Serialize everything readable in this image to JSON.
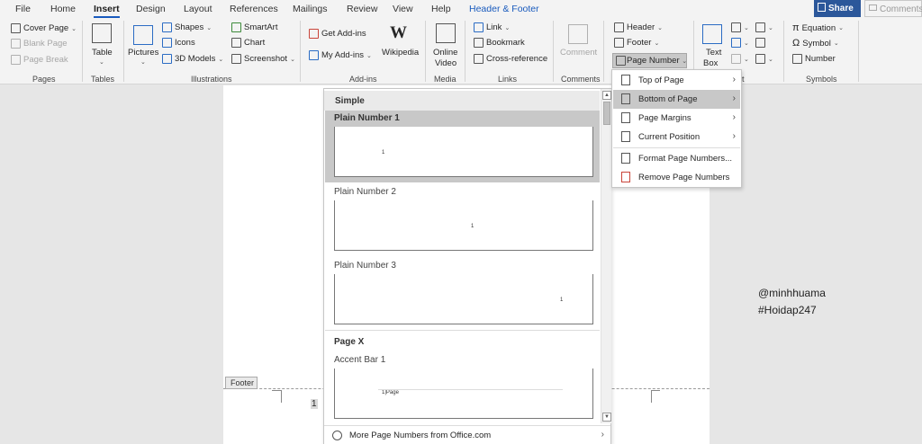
{
  "tabs": [
    "File",
    "Home",
    "Insert",
    "Design",
    "Layout",
    "References",
    "Mailings",
    "Review",
    "View",
    "Help",
    "Header & Footer"
  ],
  "share_label": "Share",
  "comments_label": "Comments",
  "ribbon": {
    "pages": {
      "cover_page": "Cover Page",
      "blank_page": "Blank Page",
      "page_break": "Page Break",
      "label": "Pages"
    },
    "tables": {
      "table": "Table",
      "label": "Tables"
    },
    "illustrations": {
      "pictures": "Pictures",
      "shapes": "Shapes",
      "icons": "Icons",
      "models_3d": "3D Models",
      "smartart": "SmartArt",
      "chart": "Chart",
      "screenshot": "Screenshot",
      "label": "Illustrations"
    },
    "addins": {
      "get_addins": "Get Add-ins",
      "my_addins": "My Add-ins",
      "wikipedia": "Wikipedia",
      "wiki_glyph": "W",
      "label": "Add-ins"
    },
    "media": {
      "online": "Online",
      "video": "Video",
      "label": "Media"
    },
    "links": {
      "link": "Link",
      "bookmark": "Bookmark",
      "cross_reference": "Cross-reference",
      "label": "Links"
    },
    "comments": {
      "comment": "Comment",
      "label": "Comments"
    },
    "header_footer": {
      "header": "Header",
      "footer": "Footer",
      "page_number": "Page Number"
    },
    "text": {
      "text": "Text",
      "box": "Box",
      "label_fragment": "t"
    },
    "symbols": {
      "equation": "Equation",
      "symbol": "Symbol",
      "number": "Number",
      "label": "Symbols"
    }
  },
  "page": {
    "footer_tag": "Footer",
    "page_number": "1"
  },
  "watermark": {
    "line1": "@minhhuama",
    "line2": "#Hoidap247"
  },
  "gallery": {
    "simple_heading": "Simple",
    "plain1": "Plain Number 1",
    "plain2": "Plain Number 2",
    "plain3": "Plain Number 3",
    "pagex_heading": "Page X",
    "accent1": "Accent Bar 1",
    "preview_num": "1",
    "accent_preview": "1|Page",
    "more": "More Page Numbers from Office.com"
  },
  "page_number_menu": [
    {
      "label": "Top of Page",
      "submenu": true
    },
    {
      "label": "Bottom of Page",
      "submenu": true
    },
    {
      "label": "Page Margins",
      "submenu": true
    },
    {
      "label": "Current Position",
      "submenu": true
    },
    {
      "label": "Format Page Numbers...",
      "submenu": false
    },
    {
      "label": "Remove Page Numbers",
      "submenu": false
    }
  ],
  "colors": {
    "accent": "#185abd",
    "share_bg": "#2b579a",
    "highlight": "#c8c8c8"
  },
  "icons": {
    "submenu_arrow": "›",
    "dropdown_arrow": "⌄"
  }
}
